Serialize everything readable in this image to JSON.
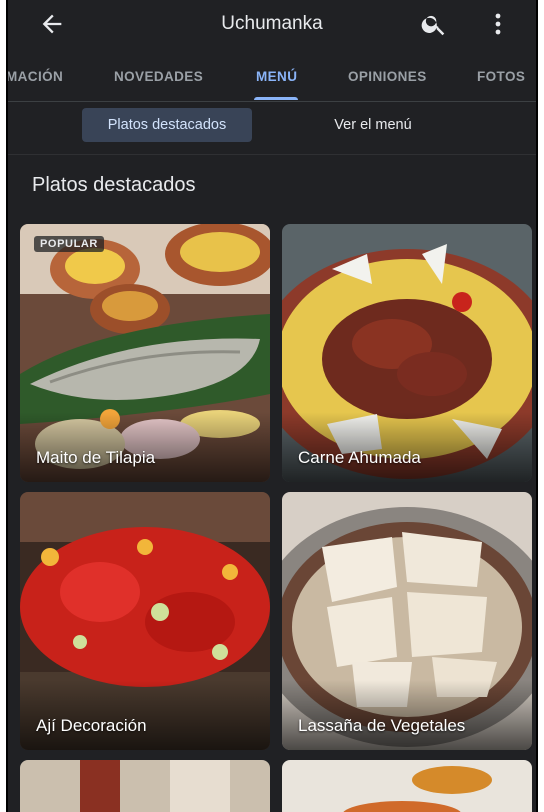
{
  "app_bar": {
    "title": "Uchumanka",
    "back_icon": "arrow-back-icon",
    "search_icon": "search-icon",
    "more_icon": "more-vert-icon"
  },
  "tabs": [
    {
      "label": "MACIÓN",
      "active": false
    },
    {
      "label": "NOVEDADES",
      "active": false
    },
    {
      "label": "MENÚ",
      "active": true
    },
    {
      "label": "OPINIONES",
      "active": false
    },
    {
      "label": "FOTOS",
      "active": false
    }
  ],
  "chips": [
    {
      "label": "Platos destacados",
      "selected": true
    },
    {
      "label": "Ver el menú",
      "selected": false
    }
  ],
  "section": {
    "title": "Platos destacados"
  },
  "dishes": [
    {
      "name": "Maito de Tilapia",
      "badge": "POPULAR"
    },
    {
      "name": "Carne Ahumada"
    },
    {
      "name": "Ají Decoración"
    },
    {
      "name": "Lassaña de Vegetales"
    }
  ],
  "colors": {
    "background": "#202124",
    "accent": "#8ab4f8",
    "chip_selected": "#394457"
  }
}
